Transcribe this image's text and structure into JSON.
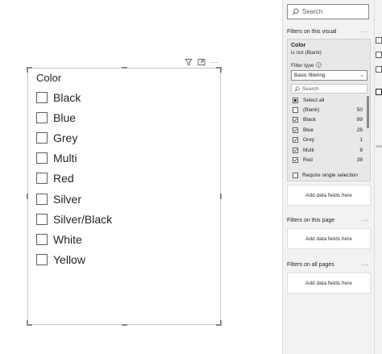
{
  "slicer": {
    "title": "Color",
    "items": [
      {
        "label": "Black"
      },
      {
        "label": "Blue"
      },
      {
        "label": "Grey"
      },
      {
        "label": "Multi"
      },
      {
        "label": "Red"
      },
      {
        "label": "Silver"
      },
      {
        "label": "Silver/Black"
      },
      {
        "label": "White"
      },
      {
        "label": "Yellow"
      }
    ],
    "header_icons": [
      "filter-icon",
      "focus-mode-icon",
      "more-options-icon"
    ],
    "more_label": "···"
  },
  "filters_pane": {
    "search_placeholder": "Search",
    "visual_section": {
      "title": "Filters on this visual",
      "more": "···",
      "card": {
        "field": "Color",
        "condition": "is not (Blank)",
        "filter_type_label": "Filter type",
        "filter_type_value": "Basic filtering",
        "search_placeholder": "Search",
        "rows": [
          {
            "label": "Select all",
            "count": "",
            "state": "partial"
          },
          {
            "label": "(Blank)",
            "count": "50",
            "state": "unchecked"
          },
          {
            "label": "Black",
            "count": "89",
            "state": "checked"
          },
          {
            "label": "Blue",
            "count": "26",
            "state": "checked"
          },
          {
            "label": "Grey",
            "count": "1",
            "state": "checked"
          },
          {
            "label": "Multi",
            "count": "8",
            "state": "checked"
          },
          {
            "label": "Red",
            "count": "38",
            "state": "checked"
          }
        ],
        "single_select_label": "Require single selection"
      },
      "add_fields": "Add data fields here"
    },
    "page_section": {
      "title": "Filters on this page",
      "more": "···",
      "add_fields": "Add data fields here"
    },
    "all_pages_section": {
      "title": "Filters on all pages",
      "more": "···",
      "add_fields": "Add data fields here"
    }
  },
  "colors": {
    "accent": "#252423",
    "pane_bg": "#f3f2f1",
    "border": "#c8c6c4"
  }
}
